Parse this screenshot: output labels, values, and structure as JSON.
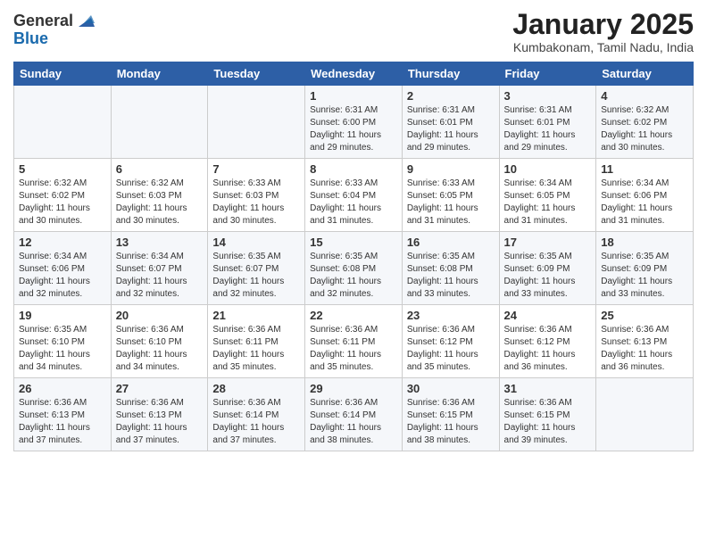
{
  "logo": {
    "general": "General",
    "blue": "Blue"
  },
  "header": {
    "title": "January 2025",
    "subtitle": "Kumbakonam, Tamil Nadu, India"
  },
  "days_of_week": [
    "Sunday",
    "Monday",
    "Tuesday",
    "Wednesday",
    "Thursday",
    "Friday",
    "Saturday"
  ],
  "weeks": [
    [
      {
        "day": "",
        "info": ""
      },
      {
        "day": "",
        "info": ""
      },
      {
        "day": "",
        "info": ""
      },
      {
        "day": "1",
        "info": "Sunrise: 6:31 AM\nSunset: 6:00 PM\nDaylight: 11 hours\nand 29 minutes."
      },
      {
        "day": "2",
        "info": "Sunrise: 6:31 AM\nSunset: 6:01 PM\nDaylight: 11 hours\nand 29 minutes."
      },
      {
        "day": "3",
        "info": "Sunrise: 6:31 AM\nSunset: 6:01 PM\nDaylight: 11 hours\nand 29 minutes."
      },
      {
        "day": "4",
        "info": "Sunrise: 6:32 AM\nSunset: 6:02 PM\nDaylight: 11 hours\nand 30 minutes."
      }
    ],
    [
      {
        "day": "5",
        "info": "Sunrise: 6:32 AM\nSunset: 6:02 PM\nDaylight: 11 hours\nand 30 minutes."
      },
      {
        "day": "6",
        "info": "Sunrise: 6:32 AM\nSunset: 6:03 PM\nDaylight: 11 hours\nand 30 minutes."
      },
      {
        "day": "7",
        "info": "Sunrise: 6:33 AM\nSunset: 6:03 PM\nDaylight: 11 hours\nand 30 minutes."
      },
      {
        "day": "8",
        "info": "Sunrise: 6:33 AM\nSunset: 6:04 PM\nDaylight: 11 hours\nand 31 minutes."
      },
      {
        "day": "9",
        "info": "Sunrise: 6:33 AM\nSunset: 6:05 PM\nDaylight: 11 hours\nand 31 minutes."
      },
      {
        "day": "10",
        "info": "Sunrise: 6:34 AM\nSunset: 6:05 PM\nDaylight: 11 hours\nand 31 minutes."
      },
      {
        "day": "11",
        "info": "Sunrise: 6:34 AM\nSunset: 6:06 PM\nDaylight: 11 hours\nand 31 minutes."
      }
    ],
    [
      {
        "day": "12",
        "info": "Sunrise: 6:34 AM\nSunset: 6:06 PM\nDaylight: 11 hours\nand 32 minutes."
      },
      {
        "day": "13",
        "info": "Sunrise: 6:34 AM\nSunset: 6:07 PM\nDaylight: 11 hours\nand 32 minutes."
      },
      {
        "day": "14",
        "info": "Sunrise: 6:35 AM\nSunset: 6:07 PM\nDaylight: 11 hours\nand 32 minutes."
      },
      {
        "day": "15",
        "info": "Sunrise: 6:35 AM\nSunset: 6:08 PM\nDaylight: 11 hours\nand 32 minutes."
      },
      {
        "day": "16",
        "info": "Sunrise: 6:35 AM\nSunset: 6:08 PM\nDaylight: 11 hours\nand 33 minutes."
      },
      {
        "day": "17",
        "info": "Sunrise: 6:35 AM\nSunset: 6:09 PM\nDaylight: 11 hours\nand 33 minutes."
      },
      {
        "day": "18",
        "info": "Sunrise: 6:35 AM\nSunset: 6:09 PM\nDaylight: 11 hours\nand 33 minutes."
      }
    ],
    [
      {
        "day": "19",
        "info": "Sunrise: 6:35 AM\nSunset: 6:10 PM\nDaylight: 11 hours\nand 34 minutes."
      },
      {
        "day": "20",
        "info": "Sunrise: 6:36 AM\nSunset: 6:10 PM\nDaylight: 11 hours\nand 34 minutes."
      },
      {
        "day": "21",
        "info": "Sunrise: 6:36 AM\nSunset: 6:11 PM\nDaylight: 11 hours\nand 35 minutes."
      },
      {
        "day": "22",
        "info": "Sunrise: 6:36 AM\nSunset: 6:11 PM\nDaylight: 11 hours\nand 35 minutes."
      },
      {
        "day": "23",
        "info": "Sunrise: 6:36 AM\nSunset: 6:12 PM\nDaylight: 11 hours\nand 35 minutes."
      },
      {
        "day": "24",
        "info": "Sunrise: 6:36 AM\nSunset: 6:12 PM\nDaylight: 11 hours\nand 36 minutes."
      },
      {
        "day": "25",
        "info": "Sunrise: 6:36 AM\nSunset: 6:13 PM\nDaylight: 11 hours\nand 36 minutes."
      }
    ],
    [
      {
        "day": "26",
        "info": "Sunrise: 6:36 AM\nSunset: 6:13 PM\nDaylight: 11 hours\nand 37 minutes."
      },
      {
        "day": "27",
        "info": "Sunrise: 6:36 AM\nSunset: 6:13 PM\nDaylight: 11 hours\nand 37 minutes."
      },
      {
        "day": "28",
        "info": "Sunrise: 6:36 AM\nSunset: 6:14 PM\nDaylight: 11 hours\nand 37 minutes."
      },
      {
        "day": "29",
        "info": "Sunrise: 6:36 AM\nSunset: 6:14 PM\nDaylight: 11 hours\nand 38 minutes."
      },
      {
        "day": "30",
        "info": "Sunrise: 6:36 AM\nSunset: 6:15 PM\nDaylight: 11 hours\nand 38 minutes."
      },
      {
        "day": "31",
        "info": "Sunrise: 6:36 AM\nSunset: 6:15 PM\nDaylight: 11 hours\nand 39 minutes."
      },
      {
        "day": "",
        "info": ""
      }
    ]
  ]
}
